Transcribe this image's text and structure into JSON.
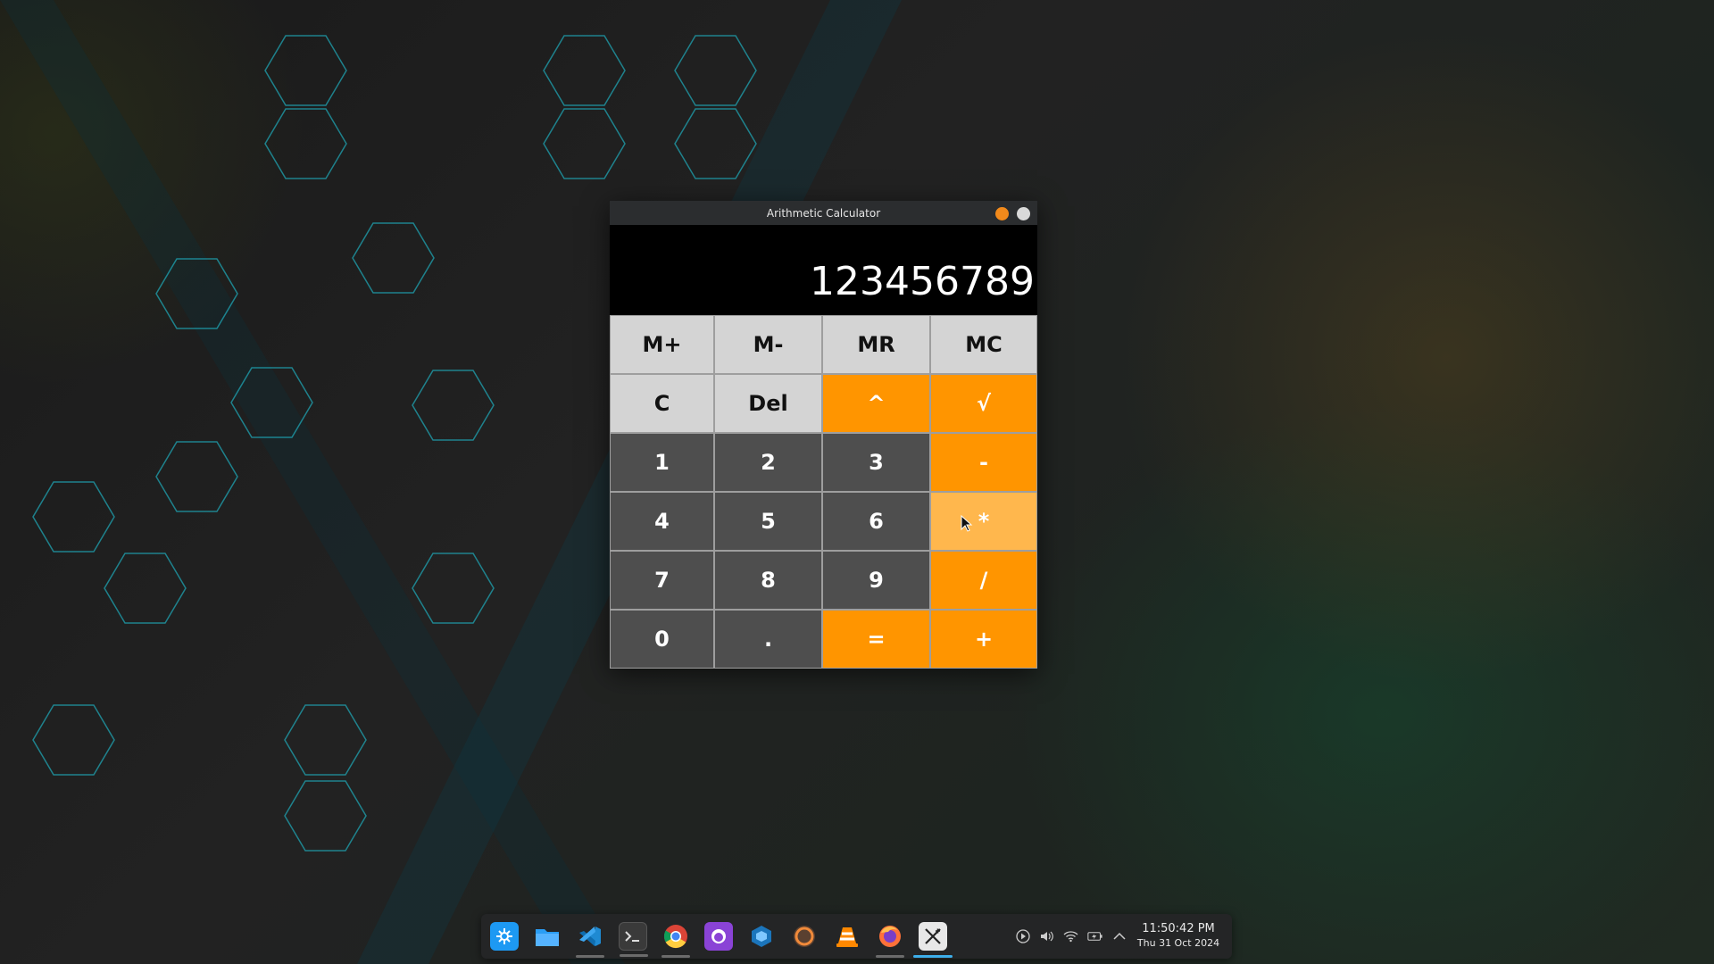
{
  "window": {
    "title": "Arithmetic Calculator"
  },
  "display": {
    "value": "123456789"
  },
  "keypad": {
    "rows": [
      [
        "M+",
        "M-",
        "MR",
        "MC"
      ],
      [
        "C",
        "Del",
        "^",
        "√"
      ],
      [
        "1",
        "2",
        "3",
        "-"
      ],
      [
        "4",
        "5",
        "6",
        "*"
      ],
      [
        "7",
        "8",
        "9",
        "/"
      ],
      [
        "0",
        ".",
        "=",
        "+"
      ]
    ]
  },
  "colors": {
    "accent": "#ff9500",
    "hover_accent": "#ffb74d",
    "digit_key": "#4e4e4e",
    "function_key": "#d4d4d4",
    "taskbar_active": "#3daee9"
  },
  "taskbar": {
    "apps": [
      "kde-launcher-icon",
      "files-icon",
      "vscode-icon",
      "terminal-icon",
      "chrome-icon",
      "github-desktop-icon",
      "virtualbox-icon",
      "sublime-icon",
      "vlc-icon",
      "firefox-icon",
      "calculator-app-icon"
    ],
    "tray": [
      "media-play-icon",
      "volume-icon",
      "wifi-icon",
      "battery-icon",
      "tray-expand-icon"
    ],
    "clock": {
      "time": "11:50:42 PM",
      "date": "Thu 31 Oct 2024"
    }
  }
}
